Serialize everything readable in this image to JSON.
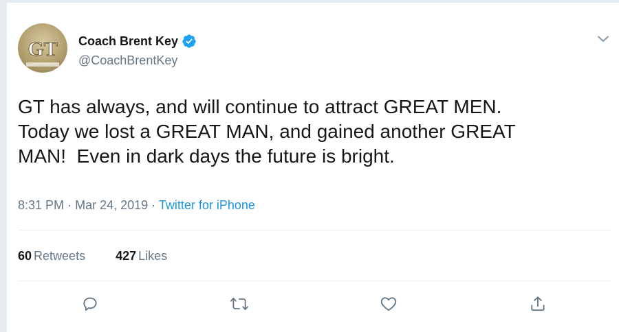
{
  "tweet": {
    "author": {
      "display_name": "Coach Brent Key",
      "handle": "@CoachBrentKey",
      "verified": true,
      "avatar_logo_text": "GT"
    },
    "text": "GT has always, and will continue to attract GREAT MEN.\nToday we lost a GREAT MAN, and gained another GREAT\nMAN!  Even in dark days the future is bright.",
    "time": "8:31 PM",
    "separator": "·",
    "date": "Mar 24, 2019",
    "source": "Twitter for iPhone",
    "stats": {
      "retweets_count": "60",
      "retweets_label": "Retweets",
      "likes_count": "427",
      "likes_label": "Likes"
    }
  },
  "icons": {
    "verified": "verified-badge-icon",
    "caret": "chevron-down-icon",
    "reply": "reply-icon",
    "retweet": "retweet-icon",
    "like": "heart-icon",
    "share": "share-icon"
  },
  "colors": {
    "text": "#14171a",
    "secondary": "#657786",
    "link": "#1b95e0",
    "verified": "#1da1f2",
    "divider": "#e6ecf0"
  }
}
